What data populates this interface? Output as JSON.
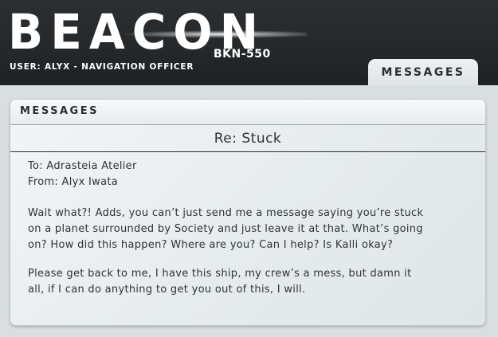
{
  "app": {
    "title": "BEACON",
    "ship_id": "BKN-550",
    "user_line": "USER: ALYX - NAVIGATION OFFICER"
  },
  "nav": {
    "active_tab": "MESSAGES"
  },
  "window": {
    "title": "MESSAGES"
  },
  "message": {
    "subject": "Re: Stuck",
    "to": "To: Adrasteia Atelier",
    "from": "From: Alyx Iwata",
    "paragraph1_lines": [
      "Wait what?! Adds, you can’t just send me a message saying you’re stuck",
      "on a planet surrounded by Society and just leave it at that. What’s going",
      "on? How did this happen? Where are you? Can I help? Is Kalli okay?"
    ],
    "paragraph2_lines": [
      "Please get back to me, I have this ship, my crew’s a mess, but damn it",
      "all, if I can do anything to get you out of this, I will."
    ]
  }
}
